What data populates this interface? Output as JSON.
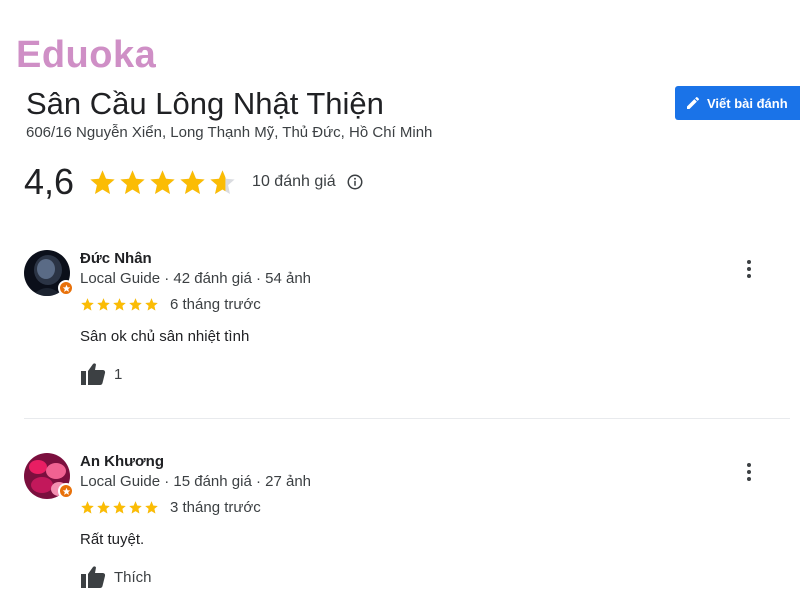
{
  "brand": {
    "logo_text": "Eduoka"
  },
  "place": {
    "name": "Sân Cầu Lông Nhật Thiện",
    "address": "606/16 Nguyễn Xiển, Long Thạnh Mỹ, Thủ Đức, Hồ Chí Minh"
  },
  "write_review": {
    "label": "Viết bài đánh",
    "icon": "pencil-icon"
  },
  "rating": {
    "value_text": "4,6",
    "value": 4.6,
    "max": 5,
    "count_text": "10 đánh giá",
    "star_color": "#fbbc04",
    "empty_star_color": "#dadce0"
  },
  "reviews": [
    {
      "name": "Đức Nhân",
      "meta": "Local Guide · 42 đánh giá · 54 ảnh",
      "stars": 5,
      "time": "6 tháng trước",
      "text": "Sân ok chủ sân nhiệt tình",
      "like_label": "1",
      "avatar_colors": [
        "#0b0f1a",
        "#5a6b86"
      ]
    },
    {
      "name": "An Khương",
      "meta": "Local Guide · 15 đánh giá · 27 ảnh",
      "stars": 5,
      "time": "3 tháng trước",
      "text": "Rất tuyệt.",
      "like_label": "Thích",
      "avatar_colors": [
        "#c2185b",
        "#f48fb1"
      ]
    }
  ],
  "colors": {
    "accent": "#1a73e8",
    "badge": "#e8710a",
    "logo": "#cf8fc6"
  }
}
